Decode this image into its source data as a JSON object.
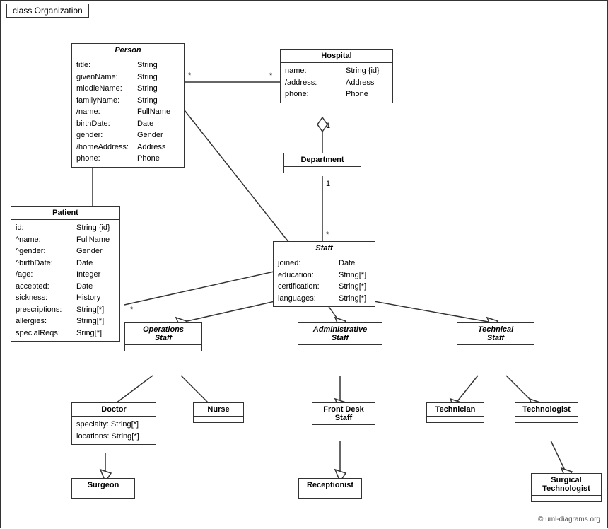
{
  "diagram": {
    "title": "class Organization",
    "copyright": "© uml-diagrams.org",
    "boxes": {
      "person": {
        "title": "Person",
        "italic": true,
        "attrs": [
          {
            "name": "title:",
            "type": "String"
          },
          {
            "name": "givenName:",
            "type": "String"
          },
          {
            "name": "middleName:",
            "type": "String"
          },
          {
            "name": "familyName:",
            "type": "String"
          },
          {
            "name": "/name:",
            "type": "FullName"
          },
          {
            "name": "birthDate:",
            "type": "Date"
          },
          {
            "name": "gender:",
            "type": "Gender"
          },
          {
            "name": "/homeAddress:",
            "type": "Address"
          },
          {
            "name": "phone:",
            "type": "Phone"
          }
        ]
      },
      "hospital": {
        "title": "Hospital",
        "attrs": [
          {
            "name": "name:",
            "type": "String {id}"
          },
          {
            "name": "/address:",
            "type": "Address"
          },
          {
            "name": "phone:",
            "type": "Phone"
          }
        ]
      },
      "patient": {
        "title": "Patient",
        "attrs": [
          {
            "name": "id:",
            "type": "String {id}"
          },
          {
            "name": "^name:",
            "type": "FullName"
          },
          {
            "name": "^gender:",
            "type": "Gender"
          },
          {
            "name": "^birthDate:",
            "type": "Date"
          },
          {
            "name": "/age:",
            "type": "Integer"
          },
          {
            "name": "accepted:",
            "type": "Date"
          },
          {
            "name": "sickness:",
            "type": "History"
          },
          {
            "name": "prescriptions:",
            "type": "String[*]"
          },
          {
            "name": "allergies:",
            "type": "String[*]"
          },
          {
            "name": "specialReqs:",
            "type": "Sring[*]"
          }
        ]
      },
      "department": {
        "title": "Department",
        "attrs": []
      },
      "staff": {
        "title": "Staff",
        "italic": true,
        "attrs": [
          {
            "name": "joined:",
            "type": "Date"
          },
          {
            "name": "education:",
            "type": "String[*]"
          },
          {
            "name": "certification:",
            "type": "String[*]"
          },
          {
            "name": "languages:",
            "type": "String[*]"
          }
        ]
      },
      "operations_staff": {
        "title": "Operations Staff",
        "italic": true,
        "attrs": []
      },
      "administrative_staff": {
        "title": "Administrative Staff",
        "italic": true,
        "attrs": []
      },
      "technical_staff": {
        "title": "Technical Staff",
        "italic": true,
        "attrs": []
      },
      "doctor": {
        "title": "Doctor",
        "attrs": [
          {
            "name": "specialty:",
            "type": "String[*]"
          },
          {
            "name": "locations:",
            "type": "String[*]"
          }
        ]
      },
      "nurse": {
        "title": "Nurse",
        "attrs": []
      },
      "front_desk_staff": {
        "title": "Front Desk Staff",
        "attrs": []
      },
      "technician": {
        "title": "Technician",
        "attrs": []
      },
      "technologist": {
        "title": "Technologist",
        "attrs": []
      },
      "surgeon": {
        "title": "Surgeon",
        "attrs": []
      },
      "receptionist": {
        "title": "Receptionist",
        "attrs": []
      },
      "surgical_technologist": {
        "title": "Surgical Technologist",
        "attrs": []
      }
    }
  }
}
